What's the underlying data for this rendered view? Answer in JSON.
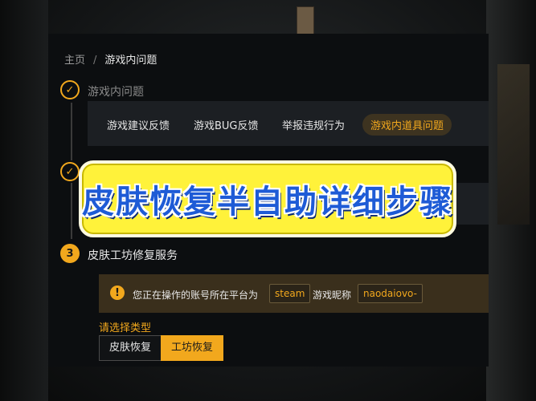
{
  "breadcrumb": {
    "home": "主页",
    "separator": "/",
    "current": "游戏内问题"
  },
  "steps": [
    {
      "status": "done",
      "title": "游戏内问题"
    },
    {
      "status": "done",
      "title": ""
    },
    {
      "status": "active",
      "number": "3",
      "title": "皮肤工坊修复服务"
    }
  ],
  "categories": [
    {
      "label": "游戏建议反馈",
      "active": false
    },
    {
      "label": "游戏BUG反馈",
      "active": false
    },
    {
      "label": "举报违规行为",
      "active": false
    },
    {
      "label": "游戏内道具问题",
      "active": true
    }
  ],
  "info": {
    "icon": "warning-icon",
    "text_prefix": "您正在操作的账号所在平台为",
    "platform": "steam",
    "nickname_label": "游戏昵称",
    "nickname": "naodaiovo-"
  },
  "type_select": {
    "label": "请选择类型",
    "options": [
      {
        "label": "皮肤恢复",
        "selected": false
      },
      {
        "label": "工坊恢复",
        "selected": true
      }
    ]
  },
  "banner": {
    "text": "皮肤恢复半自助详细步骤"
  },
  "colors": {
    "accent": "#f2a81d",
    "panel": "#0c0e10",
    "banner_bg": "#fff23a",
    "banner_text": "#1e5bd6"
  }
}
